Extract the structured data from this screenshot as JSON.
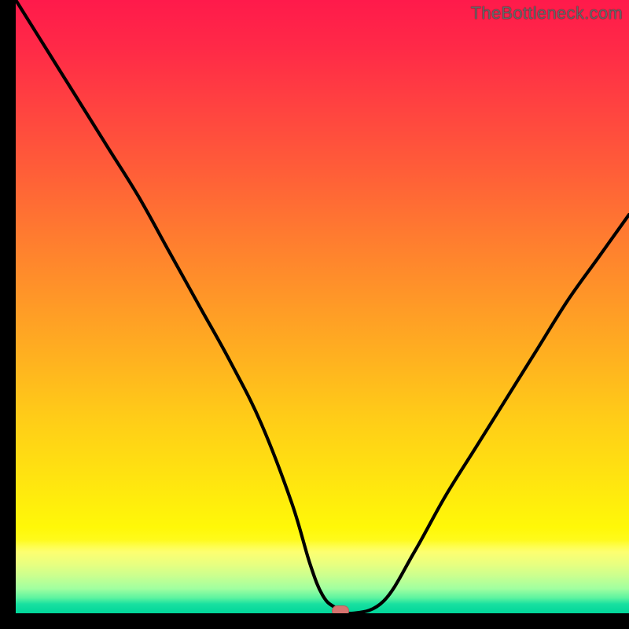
{
  "watermark": "TheBottleneck.com",
  "chart_data": {
    "type": "line",
    "title": "",
    "xlabel": "",
    "ylabel": "",
    "xlim": [
      0,
      100
    ],
    "ylim": [
      0,
      100
    ],
    "x": [
      0,
      5,
      10,
      15,
      20,
      25,
      30,
      35,
      40,
      45,
      48,
      50,
      52,
      55,
      60,
      65,
      70,
      75,
      80,
      85,
      90,
      95,
      100
    ],
    "values": [
      100,
      92,
      84,
      76,
      68,
      59,
      50,
      41,
      31,
      18,
      8,
      3,
      1,
      0,
      2,
      10,
      19,
      27,
      35,
      43,
      51,
      58,
      65
    ],
    "marker": {
      "x": 53,
      "y": 0
    },
    "background_gradient": {
      "direction": "vertical",
      "stops": [
        {
          "pos": 0.0,
          "color": "#ff1a4b"
        },
        {
          "pos": 0.3,
          "color": "#ff6a34"
        },
        {
          "pos": 0.6,
          "color": "#ffc01a"
        },
        {
          "pos": 0.88,
          "color": "#feff40"
        },
        {
          "pos": 0.94,
          "color": "#c8ff90"
        },
        {
          "pos": 1.0,
          "color": "#00d69a"
        }
      ]
    }
  }
}
